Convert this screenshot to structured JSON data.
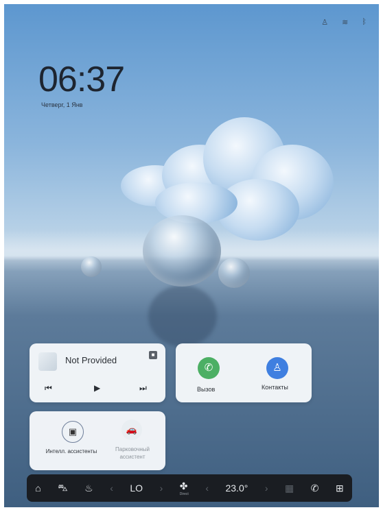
{
  "clock": {
    "time": "06:37",
    "date": "Четверг, 1 Янв"
  },
  "status": {
    "icons": [
      "user-icon",
      "signal-icon",
      "bluetooth-icon"
    ]
  },
  "media": {
    "title": "Not Provided",
    "controls": {
      "prev": "⏮",
      "play": "▶",
      "next": "⏭"
    }
  },
  "phone": {
    "call_label": "Вызов",
    "contacts_label": "Контакты"
  },
  "assistants": {
    "intelligent_label": "Интелл. ассистенты",
    "parking_label_line1": "Парковочный",
    "parking_label_line2": "ассистент"
  },
  "dock": {
    "fan_level": "LO",
    "fan_mode": "Direct",
    "temperature": "23.0°",
    "arrow_left": "‹",
    "arrow_right": "›"
  },
  "colors": {
    "call_green": "#4caf64",
    "contacts_blue": "#3f7fe0",
    "dock_bg": "#1a1d22"
  }
}
